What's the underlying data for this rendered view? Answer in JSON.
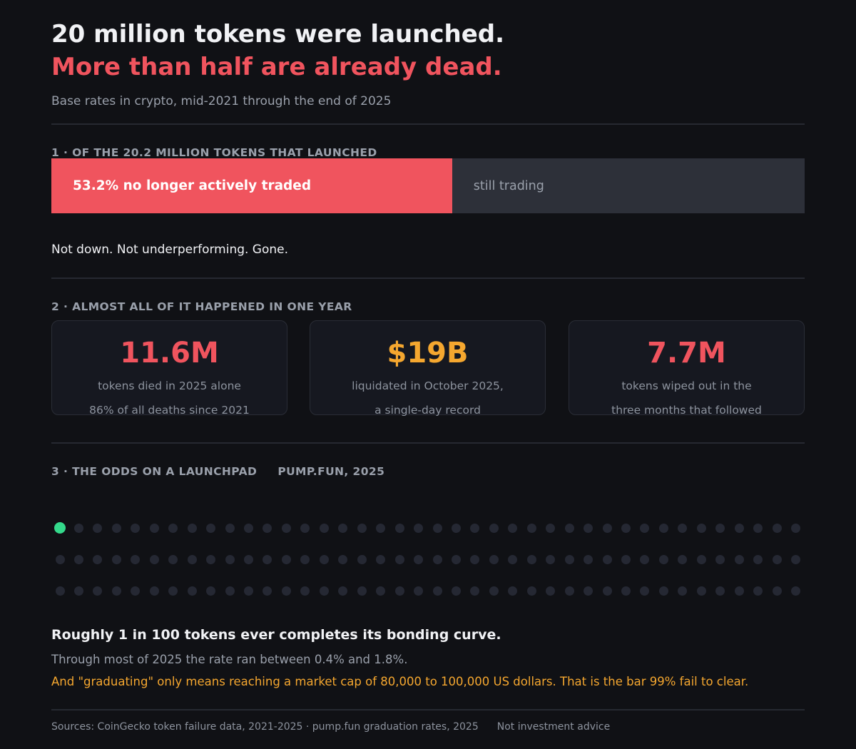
{
  "header": {
    "title_line1": "20 million tokens were launched.",
    "title_line2": "More than half are already dead.",
    "subtitle": "Base rates in crypto, mid-2021 through the end of 2025"
  },
  "section1": {
    "label": "1  ·  OF THE 20.2 MILLION TOKENS THAT LAUNCHED",
    "dead_label": "53.2% no longer actively traded",
    "dead_fraction": 0.532,
    "alive_label": "still trading",
    "caption": "Not down. Not underperforming. Gone."
  },
  "section2": {
    "label": "2  ·  ALMOST ALL OF IT HAPPENED IN ONE YEAR",
    "cards": [
      {
        "value": "11.6M",
        "line1": "tokens died in 2025 alone",
        "line2": "86% of all deaths since 2021",
        "color": "#f0545e"
      },
      {
        "value": "$19B",
        "line1": "liquidated in October 2025,",
        "line2": "a single-day record",
        "color": "#f5a72f"
      },
      {
        "value": "7.7M",
        "line1": "tokens wiped out in the",
        "line2": "three months that followed",
        "color": "#f0545e"
      }
    ]
  },
  "section3": {
    "label": "3  ·  THE ODDS ON A LAUNCHPAD",
    "sublabel": "PUMP.FUN, 2025",
    "dot_total": 120,
    "dot_highlighted": 1,
    "highlight_color": "#34d98b",
    "headline": "Roughly 1 in 100 tokens ever completes its bonding curve.",
    "rate": "Through most of 2025 the rate ran between 0.4% and 1.8%.",
    "note": "And \"graduating\" only means reaching a market cap of 80,000 to 100,000 US dollars. That is the bar 99% fail to clear."
  },
  "footer": {
    "sources": "Sources: CoinGecko token failure data, 2021-2025  ·  pump.fun graduation rates, 2025",
    "disclaimer": "Not investment advice"
  }
}
